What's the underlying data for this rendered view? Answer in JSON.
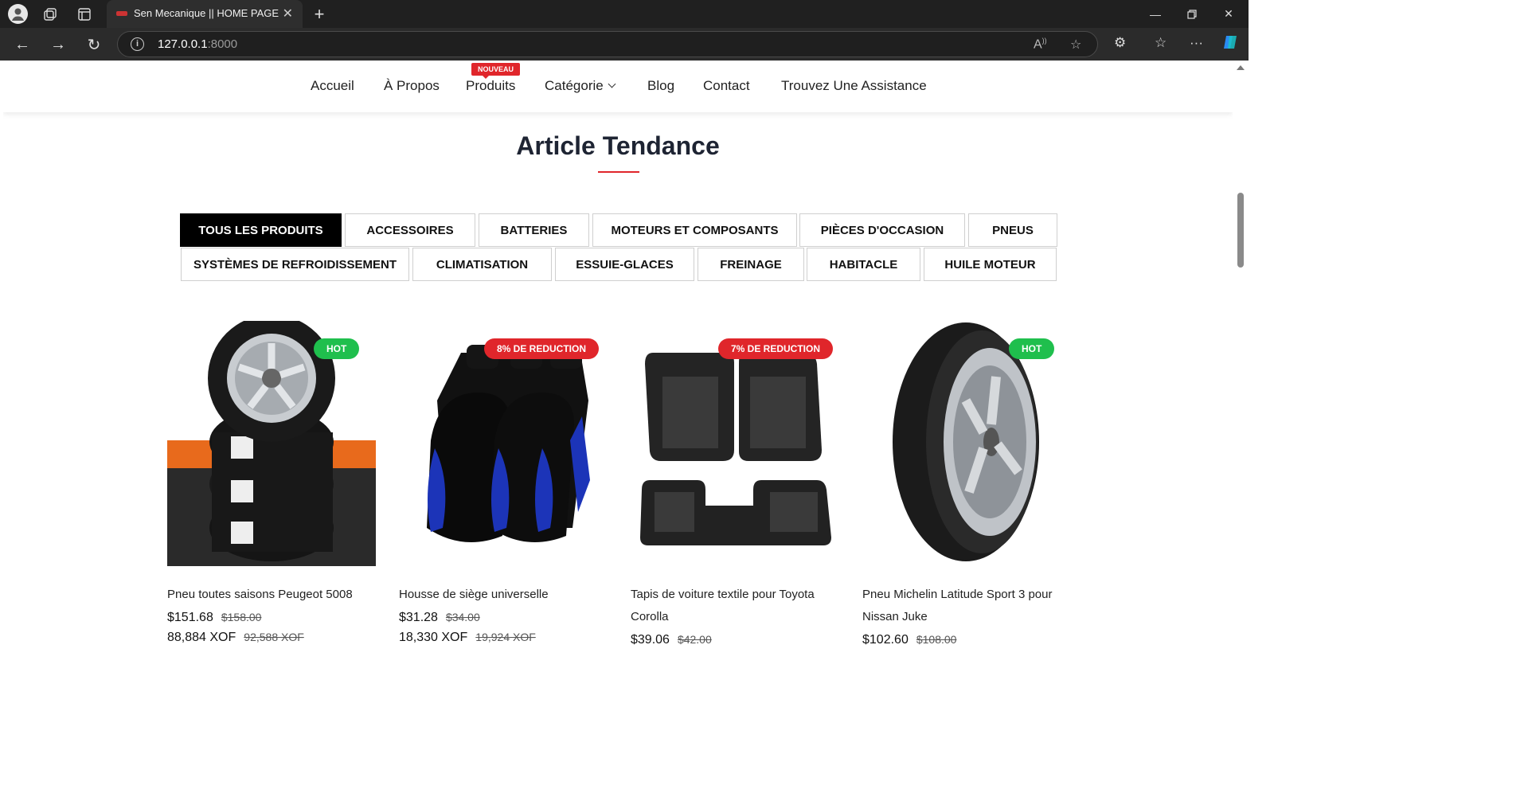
{
  "browser": {
    "tab_title": "Sen Mecanique || HOME PAGE",
    "url_host": "127.0.0.1",
    "url_port": ":8000"
  },
  "nav": {
    "items": [
      "Accueil",
      "À Propos",
      "Produits",
      "Catégorie",
      "Blog",
      "Contact",
      "Trouvez Une Assistance"
    ],
    "new_badge": "NOUVEAU"
  },
  "section": {
    "title": "Article Tendance"
  },
  "filters": {
    "row1": [
      "TOUS LES PRODUITS",
      "ACCESSOIRES",
      "BATTERIES",
      "MOTEURS ET COMPOSANTS",
      "PIÈCES D'OCCASION",
      "PNEUS"
    ],
    "row2": [
      "SYSTÈMES DE REFROIDISSEMENT",
      "CLIMATISATION",
      "ESSUIE-GLACES",
      "FREINAGE",
      "HABITACLE",
      "HUILE MOTEUR"
    ],
    "active": "TOUS LES PRODUITS"
  },
  "products": [
    {
      "badge": "HOT",
      "name": "Pneu toutes saisons Peugeot 5008",
      "price": "$151.68",
      "old_price": "$158.00",
      "price_xof": "88,884 XOF",
      "old_price_xof": "92,588 XOF"
    },
    {
      "badge": "8% DE REDUCTION",
      "name": "Housse de siège universelle",
      "price": "$31.28",
      "old_price": "$34.00",
      "price_xof": "18,330 XOF",
      "old_price_xof": "19,924 XOF"
    },
    {
      "badge": "7% DE REDUCTION",
      "name": "Tapis de voiture textile pour Toyota Corolla",
      "price": "$39.06",
      "old_price": "$42.00",
      "price_xof": "",
      "old_price_xof": ""
    },
    {
      "badge": "HOT",
      "name": "Pneu Michelin Latitude Sport 3 pour Nissan Juke",
      "price": "$102.60",
      "old_price": "$108.00",
      "price_xof": "",
      "old_price_xof": ""
    }
  ],
  "colors": {
    "accent": "#e0262b",
    "hot": "#1fbf4d",
    "dark": "#1e2433"
  }
}
